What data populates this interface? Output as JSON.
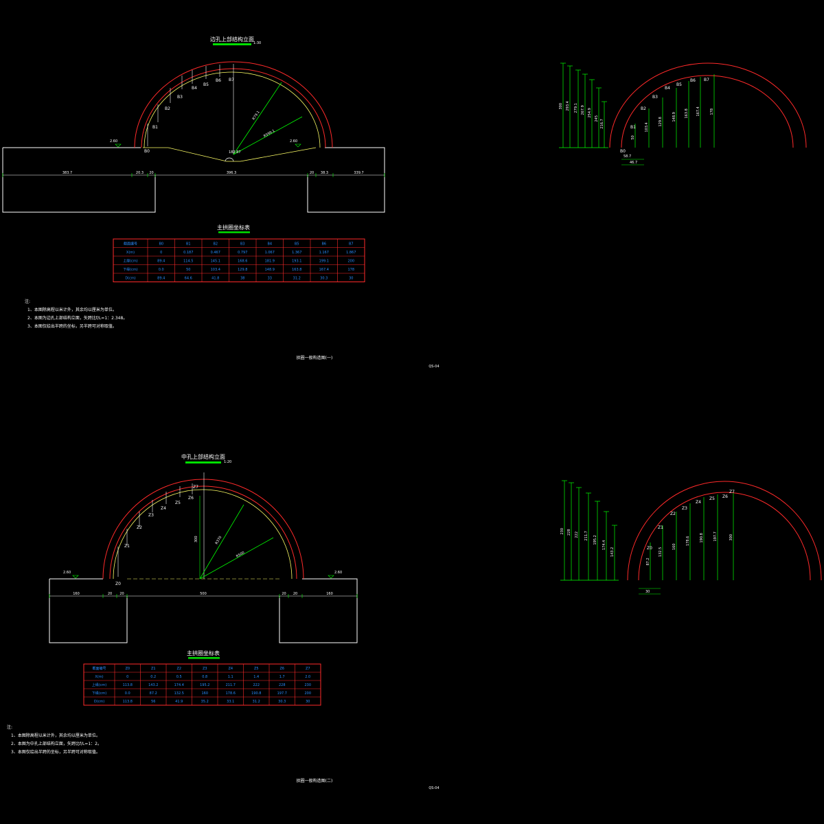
{
  "colors": {
    "background": "#000000",
    "outline": "#ffffff",
    "arch_outer": "#ff2a2a",
    "arch_inner": "#ffff66",
    "leader": "#00ff00",
    "table_border": "#ff2a2a",
    "table_text": "#2a8cff",
    "title_underline": "#00e000"
  },
  "sheet1": {
    "title": "边孔上部结构立面",
    "scale": "1:30",
    "table_title": "主拱圈坐标表",
    "left_elev": "2.60",
    "right_elev": "2.60",
    "dims": [
      "383.7",
      "20.3",
      "20",
      "396.3",
      "20",
      "38.3",
      "339.7"
    ],
    "radius_outer": "R79.1",
    "radius_inner": "R599.1",
    "arch_labels": [
      "B0",
      "B1",
      "B2",
      "B3",
      "B4",
      "B5",
      "B6",
      "B7"
    ],
    "center_label": "182.87",
    "table": {
      "headers": [
        "截面编号",
        "B0",
        "B1",
        "B2",
        "B3",
        "B4",
        "B5",
        "B6",
        "B7"
      ],
      "rows": [
        [
          "X(m)",
          "0",
          "0.187",
          "0.467",
          "0.797",
          "1.067",
          "1.367",
          "1.167",
          "1.867"
        ],
        [
          "上缘(cm)",
          "89.4",
          "114.5",
          "145.1",
          "168.6",
          "181.9",
          "193.1",
          "199.1",
          "200"
        ],
        [
          "下缘(cm)",
          "0.0",
          "50",
          "103.4",
          "129.8",
          "148.9",
          "163.8",
          "167.4",
          "178"
        ],
        [
          "D(cm)",
          "89.4",
          "64.6",
          "41.8",
          "38",
          "33",
          "31.2",
          "30.3",
          "30"
        ]
      ]
    },
    "notes_header": "注:",
    "notes": [
      "1、本图除高程以米计外，其余均以厘米为单位。",
      "2、本图为边孔上部结构立面，矢跨比f/L=1：2.348。",
      "3、本图仅绘出半跨的坐标，另半跨可对称取值。"
    ],
    "footer_title": "拱圈一般构造图(一)",
    "footer_code": "QS-04",
    "side_dims": [
      "300",
      "293.4",
      "279.1",
      "267.9",
      "254.9",
      "245",
      "216.7"
    ],
    "side_arch_labels": [
      "B0",
      "B1",
      "B2",
      "B3",
      "B4",
      "B5",
      "B6",
      "B7"
    ],
    "side_inner_dims": [
      "50",
      "103.4",
      "129.8",
      "148.9",
      "163.8",
      "167.4",
      "178"
    ],
    "side_base_dims": [
      "58.7",
      "46.7"
    ]
  },
  "sheet2": {
    "title": "中孔上部结构立面",
    "scale": "1:20",
    "table_title": "主拱圈坐标表",
    "left_elev": "2.60",
    "right_elev": "2.60",
    "dims": [
      "160",
      "20",
      "20",
      "500",
      "20",
      "20",
      "160"
    ],
    "radius_outer": "R370",
    "radius_inner": "R500",
    "arch_labels": [
      "Z0",
      "Z1",
      "Z2",
      "Z3",
      "Z4",
      "Z5",
      "Z6",
      "Z7"
    ],
    "center_label": "300",
    "table": {
      "headers": [
        "截面编号",
        "Z0",
        "Z1",
        "Z2",
        "Z3",
        "Z4",
        "Z5",
        "Z6",
        "Z7"
      ],
      "rows": [
        [
          "X(m)",
          "0",
          "0.2",
          "0.5",
          "0.8",
          "1.1",
          "1.4",
          "1.7",
          "2.0"
        ],
        [
          "上缘(cm)",
          "113.8",
          "143.2",
          "174.4",
          "195.2",
          "211.7",
          "222",
          "228",
          "230"
        ],
        [
          "下缘(cm)",
          "0.0",
          "87.2",
          "132.5",
          "160",
          "178.6",
          "190.8",
          "197.7",
          "200"
        ],
        [
          "D(cm)",
          "113.8",
          "56",
          "41.9",
          "35.2",
          "33.1",
          "31.2",
          "30.3",
          "30"
        ]
      ]
    },
    "notes_header": "注:",
    "notes": [
      "1、本图除高程以米计外，其余均以厘米为单位。",
      "2、本图为中孔上部结构立面，矢跨比f/L=1：2。",
      "3、本图仅绘出半跨的坐标，另半跨可对称取值。"
    ],
    "footer_title": "拱圈一般构造图(二)",
    "footer_code": "QS-04",
    "side_dims": [
      "230",
      "228",
      "222",
      "211.7",
      "195.2",
      "174.4",
      "143.2"
    ],
    "side_arch_labels": [
      "Z0",
      "Z1",
      "Z2",
      "Z3",
      "Z4",
      "Z5",
      "Z6",
      "Z7"
    ],
    "side_inner_dims": [
      "87.2",
      "132.5",
      "160",
      "178.6",
      "190.8",
      "197.7",
      "300"
    ],
    "side_base_dims": [
      "30"
    ]
  }
}
